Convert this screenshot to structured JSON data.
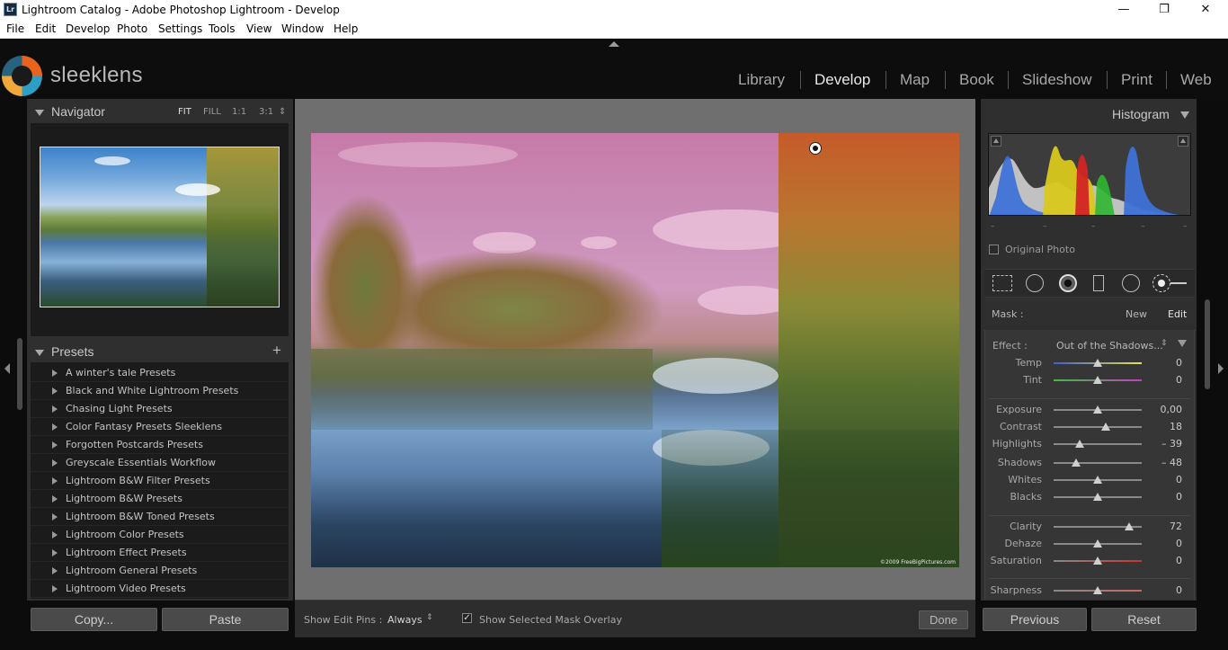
{
  "window": {
    "app_icon": "Lr",
    "title": "Lightroom Catalog - Adobe Photoshop Lightroom - Develop",
    "minimize": "—",
    "restore": "❐",
    "close": "✕"
  },
  "menu": [
    "File",
    "Edit",
    "Develop",
    "Photo",
    "Settings",
    "Tools",
    "View",
    "Window",
    "Help"
  ],
  "brand": {
    "logo_text": "sleeklens"
  },
  "modules": [
    {
      "label": "Library",
      "active": false
    },
    {
      "label": "Develop",
      "active": true
    },
    {
      "label": "Map",
      "active": false
    },
    {
      "label": "Book",
      "active": false
    },
    {
      "label": "Slideshow",
      "active": false
    },
    {
      "label": "Print",
      "active": false
    },
    {
      "label": "Web",
      "active": false
    }
  ],
  "navigator": {
    "title": "Navigator",
    "options": [
      "FIT",
      "FILL",
      "1:1",
      "3:1"
    ],
    "selected_option": "FIT",
    "spinner": "⇕"
  },
  "presets": {
    "title": "Presets",
    "add_label": "+",
    "items": [
      "A winter's tale Presets",
      "Black and White Lightroom Presets",
      "Chasing Light Presets",
      "Color Fantasy Presets Sleeklens",
      "Forgotten Postcards Presets",
      "Greyscale Essentials Workflow",
      "Lightroom B&W Filter Presets",
      "Lightroom B&W Presets",
      "Lightroom B&W Toned Presets",
      "Lightroom Color Presets",
      "Lightroom Effect Presets",
      "Lightroom General Presets",
      "Lightroom Video Presets"
    ]
  },
  "left_buttons": {
    "copy": "Copy...",
    "paste": "Paste"
  },
  "photo": {
    "copyright": "©2009 FreeBigPictures.com"
  },
  "toolbar": {
    "show_edit_pins_label": "Show Edit Pins :",
    "show_edit_pins_value": "Always",
    "overlay_checked": true,
    "overlay_label": "Show Selected Mask Overlay",
    "done": "Done"
  },
  "histogram": {
    "title": "Histogram",
    "original_photo_label": "Original Photo",
    "ticks": [
      "–",
      "–",
      "–",
      "–",
      "–"
    ]
  },
  "mask": {
    "label": "Mask :",
    "new": "New",
    "edit": "Edit"
  },
  "effect": {
    "label": "Effect :",
    "value": "Out of the Shadows..."
  },
  "sliders": [
    {
      "name": "Temp",
      "value": "0",
      "pos": 0.5,
      "group": 0
    },
    {
      "name": "Tint",
      "value": "0",
      "pos": 0.5,
      "group": 0
    },
    {
      "name": "Exposure",
      "value": "0,00",
      "pos": 0.5,
      "group": 1
    },
    {
      "name": "Contrast",
      "value": "18",
      "pos": 0.59,
      "group": 1
    },
    {
      "name": "Highlights",
      "value": "– 39",
      "pos": 0.3,
      "group": 1
    },
    {
      "name": "Shadows",
      "value": "– 48",
      "pos": 0.26,
      "group": 1
    },
    {
      "name": "Whites",
      "value": "0",
      "pos": 0.5,
      "group": 1
    },
    {
      "name": "Blacks",
      "value": "0",
      "pos": 0.5,
      "group": 1
    },
    {
      "name": "Clarity",
      "value": "72",
      "pos": 0.86,
      "group": 2
    },
    {
      "name": "Dehaze",
      "value": "0",
      "pos": 0.5,
      "group": 2
    },
    {
      "name": "Saturation",
      "value": "0",
      "pos": 0.5,
      "group": 2
    },
    {
      "name": "Sharpness",
      "value": "0",
      "pos": 0.5,
      "group": 3
    }
  ],
  "right_buttons": {
    "previous": "Previous",
    "reset": "Reset"
  },
  "colors": {
    "accent_text": "#e8e8e8",
    "panel_bg": "#2f2f2f",
    "panel_dark": "#1b1b1b",
    "center_bg": "#6f6f6f"
  }
}
